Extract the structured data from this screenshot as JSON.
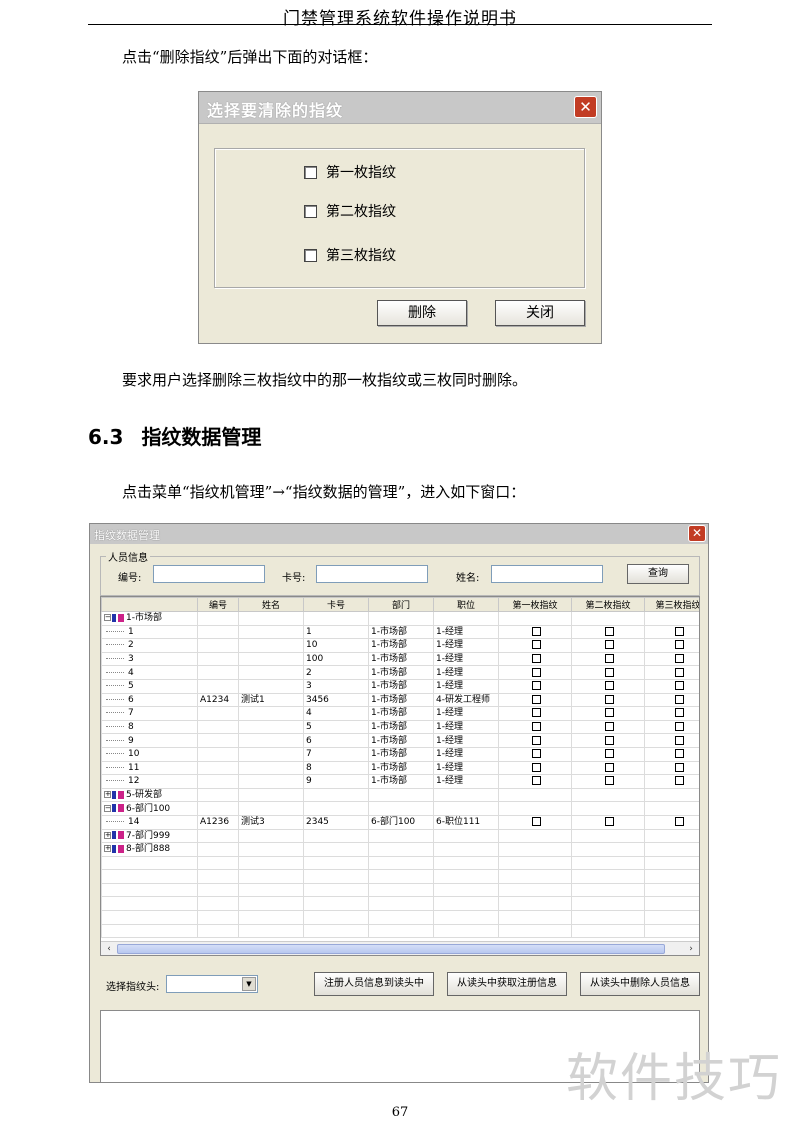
{
  "document": {
    "header": "门禁管理系统软件操作说明书",
    "intro_text": "点击“删除指纹”后弹出下面的对话框：",
    "after_dialog_text": "要求用户选择删除三枚指纹中的那一枚指纹或三枚同时删除。",
    "section_number": "6.3",
    "section_title": "指纹数据管理",
    "section_text": "点击菜单“指纹机管理”→“指纹数据的管理”，进入如下窗口：",
    "page_number": "67",
    "watermark": "软件技巧"
  },
  "delete_dialog": {
    "title": "选择要清除的指纹",
    "close_glyph": "✕",
    "options": [
      "第一枚指纹",
      "第二枚指纹",
      "第三枚指纹"
    ],
    "delete_button": "删除",
    "close_button": "关闭"
  },
  "fp_window": {
    "title": "指纹数据管理",
    "close_glyph": "✕",
    "group_label": "人员信息",
    "fields": {
      "id_label": "编号:",
      "card_label": "卡号:",
      "name_label": "姓名:",
      "id_value": "",
      "card_value": "",
      "name_value": ""
    },
    "query_button": "查询",
    "columns": [
      "",
      "编号",
      "姓名",
      "卡号",
      "部门",
      "职位",
      "第一枚指纹",
      "第二枚指纹",
      "第三枚指纹"
    ],
    "rows": [
      {
        "kind": "dept",
        "expanded": true,
        "label": "1-市场部"
      },
      {
        "kind": "person",
        "node": "1",
        "id": "",
        "name": "",
        "card": "1",
        "dept": "1-市场部",
        "position": "1-经理"
      },
      {
        "kind": "person",
        "node": "2",
        "id": "",
        "name": "",
        "card": "10",
        "dept": "1-市场部",
        "position": "1-经理"
      },
      {
        "kind": "person",
        "node": "3",
        "id": "",
        "name": "",
        "card": "100",
        "dept": "1-市场部",
        "position": "1-经理"
      },
      {
        "kind": "person",
        "node": "4",
        "id": "",
        "name": "",
        "card": "2",
        "dept": "1-市场部",
        "position": "1-经理"
      },
      {
        "kind": "person",
        "node": "5",
        "id": "",
        "name": "",
        "card": "3",
        "dept": "1-市场部",
        "position": "1-经理"
      },
      {
        "kind": "person",
        "node": "6",
        "id": "A1234",
        "name": "测试1",
        "card": "3456",
        "dept": "1-市场部",
        "position": "4-研发工程师"
      },
      {
        "kind": "person",
        "node": "7",
        "id": "",
        "name": "",
        "card": "4",
        "dept": "1-市场部",
        "position": "1-经理"
      },
      {
        "kind": "person",
        "node": "8",
        "id": "",
        "name": "",
        "card": "5",
        "dept": "1-市场部",
        "position": "1-经理"
      },
      {
        "kind": "person",
        "node": "9",
        "id": "",
        "name": "",
        "card": "6",
        "dept": "1-市场部",
        "position": "1-经理"
      },
      {
        "kind": "person",
        "node": "10",
        "id": "",
        "name": "",
        "card": "7",
        "dept": "1-市场部",
        "position": "1-经理"
      },
      {
        "kind": "person",
        "node": "11",
        "id": "",
        "name": "",
        "card": "8",
        "dept": "1-市场部",
        "position": "1-经理"
      },
      {
        "kind": "person",
        "node": "12",
        "id": "",
        "name": "",
        "card": "9",
        "dept": "1-市场部",
        "position": "1-经理"
      },
      {
        "kind": "dept",
        "expanded": false,
        "label": "5-研发部"
      },
      {
        "kind": "dept",
        "expanded": true,
        "label": "6-部门100"
      },
      {
        "kind": "person",
        "node": "14",
        "id": "A1236",
        "name": "测试3",
        "card": "2345",
        "dept": "6-部门100",
        "position": "6-职位111"
      },
      {
        "kind": "dept",
        "expanded": false,
        "label": "7-部门999"
      },
      {
        "kind": "dept",
        "expanded": false,
        "label": "8-部门888"
      }
    ],
    "empty_rows": 6,
    "reader_label": "选择指纹头:",
    "reader_value": "",
    "dropdown_glyph": "▼",
    "buttons": {
      "register": "注册人员信息到读头中",
      "fetch": "从读头中获取注册信息",
      "remove": "从读头中删除人员信息"
    },
    "scroll_left": "‹",
    "scroll_right": "›",
    "expanded_glyph": "−",
    "collapsed_glyph": "+"
  }
}
